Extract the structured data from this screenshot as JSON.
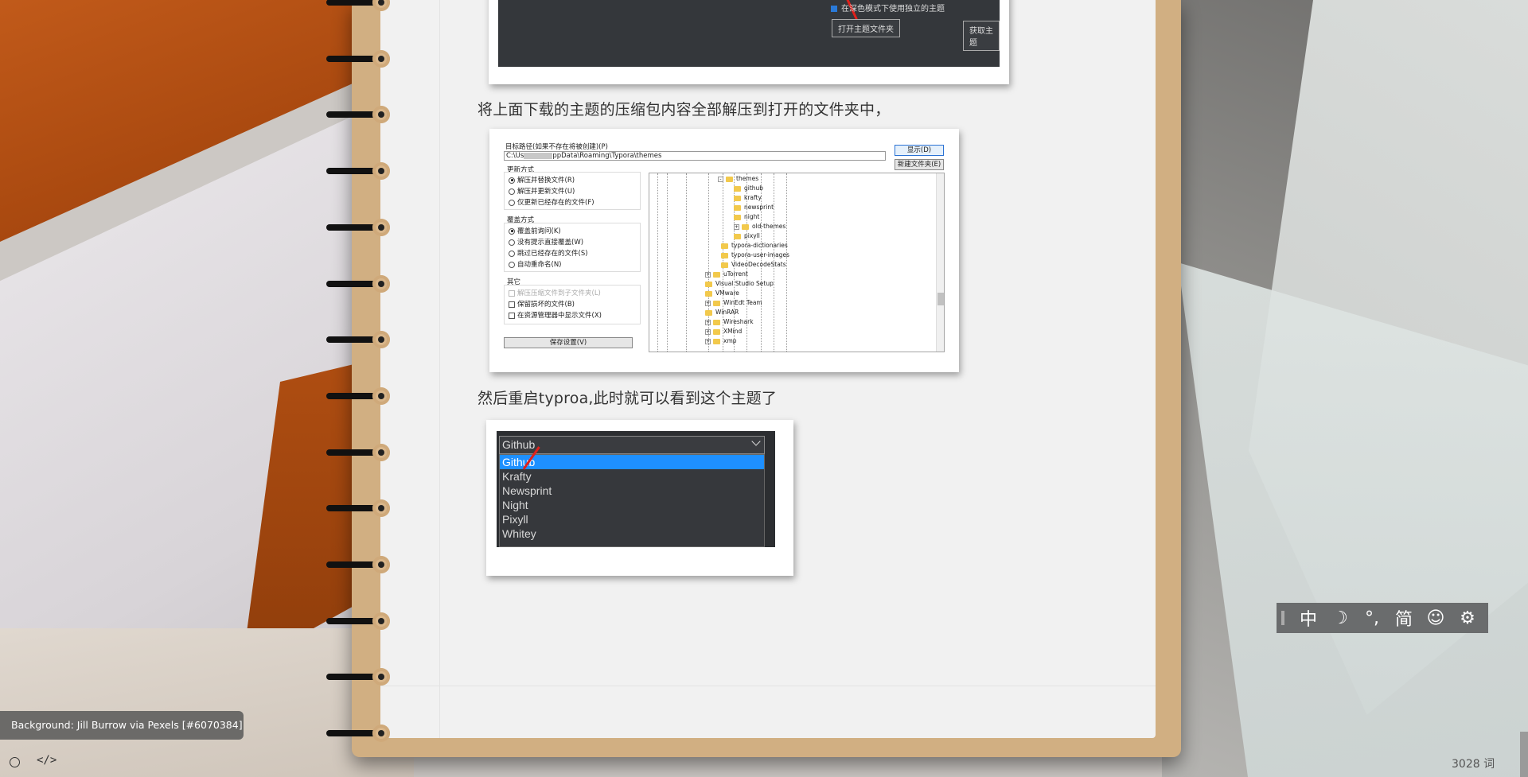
{
  "background": {
    "credit": "Background: Jill Burrow via Pexels [#6070384]"
  },
  "document": {
    "paragraphs": [
      "将上面下载的主题的压缩包内容全部解压到打开的文件夹中，",
      "然后重启typroa,此时就可以看到这个主题了"
    ]
  },
  "screenshot_theme_panel": {
    "checkbox_label": "在深色模式下使用独立的主题",
    "open_folder_button": "打开主题文件夹",
    "get_themes_button": "获取主题"
  },
  "screenshot_extract_dialog": {
    "target_path_label": "目标路径(如果不存在将被创建)(P)",
    "path_prefix": "C:\\Us",
    "path_suffix": "ppData\\Roaming\\Typora\\themes",
    "show_button": "显示(D)",
    "new_folder_button": "新建文件夹(E)",
    "update_mode_label": "更新方式",
    "update_options": [
      "解压并替换文件(R)",
      "解压并更新文件(U)",
      "仅更新已经存在的文件(F)"
    ],
    "overwrite_mode_label": "覆盖方式",
    "overwrite_options": [
      "覆盖前询问(K)",
      "没有提示直接覆盖(W)",
      "跳过已经存在的文件(S)",
      "自动重命名(N)"
    ],
    "other_label": "其它",
    "other_options": [
      "解压压缩文件到子文件夹(L)",
      "保留损坏的文件(B)",
      "在资源管理器中显示文件(X)"
    ],
    "save_settings_button": "保存设置(V)",
    "tree": [
      {
        "name": "themes",
        "level": "parent",
        "expander": "-"
      },
      {
        "name": "github",
        "level": "child",
        "expander": ""
      },
      {
        "name": "krafty",
        "level": "child",
        "expander": ""
      },
      {
        "name": "newsprint",
        "level": "child",
        "expander": ""
      },
      {
        "name": "night",
        "level": "child",
        "expander": ""
      },
      {
        "name": "old-themes",
        "level": "child",
        "expander": "+"
      },
      {
        "name": "pixyll",
        "level": "child",
        "expander": ""
      },
      {
        "name": "typora-dictionaries",
        "level": "sibling",
        "expander": ""
      },
      {
        "name": "typora-user-images",
        "level": "sibling",
        "expander": ""
      },
      {
        "name": "VideoDecodeStats",
        "level": "sibling",
        "expander": ""
      },
      {
        "name": "uTorrent",
        "level": "root",
        "expander": "+"
      },
      {
        "name": "Visual Studio Setup",
        "level": "root",
        "expander": ""
      },
      {
        "name": "VMware",
        "level": "root",
        "expander": ""
      },
      {
        "name": "WinEdt Team",
        "level": "root",
        "expander": "+"
      },
      {
        "name": "WinRAR",
        "level": "root",
        "expander": ""
      },
      {
        "name": "Wireshark",
        "level": "root",
        "expander": "+"
      },
      {
        "name": "XMind",
        "level": "root",
        "expander": "+"
      },
      {
        "name": "xmp",
        "level": "root",
        "expander": "+"
      }
    ]
  },
  "screenshot_theme_dropdown": {
    "selected": "Github",
    "options": [
      "Github",
      "Krafty",
      "Newsprint",
      "Night",
      "Pixyll",
      "Whitey"
    ]
  },
  "ime_toolbar": {
    "items": [
      {
        "name": "chinese-mode",
        "glyph": "中"
      },
      {
        "name": "moon-icon",
        "glyph": "☽"
      },
      {
        "name": "punctuation-icon",
        "glyph": "°,"
      },
      {
        "name": "simplified",
        "glyph": "简"
      },
      {
        "name": "emoji-icon",
        "glyph": "☺"
      },
      {
        "name": "settings-icon",
        "glyph": "⚙"
      }
    ]
  },
  "status_bar": {
    "code_toggle": "</>",
    "word_count": "3028 词"
  }
}
